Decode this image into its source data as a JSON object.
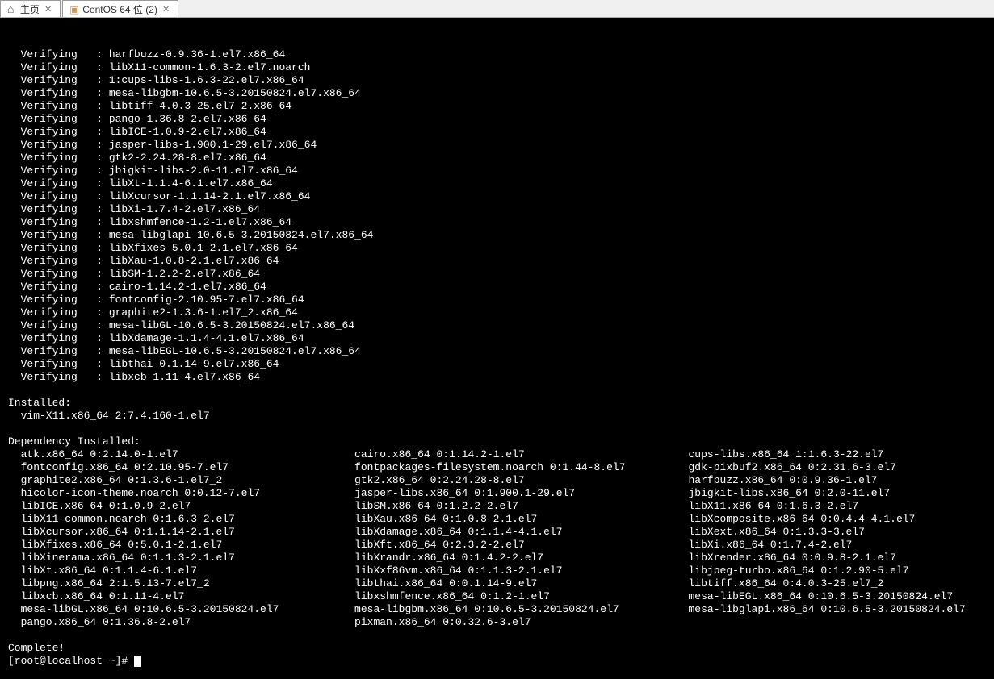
{
  "tabs": {
    "home": "主页",
    "vm": "CentOS 64 位 (2)"
  },
  "verifying_label": "Verifying",
  "verifying": [
    "harfbuzz-0.9.36-1.el7.x86_64",
    "libX11-common-1.6.3-2.el7.noarch",
    "1:cups-libs-1.6.3-22.el7.x86_64",
    "mesa-libgbm-10.6.5-3.20150824.el7.x86_64",
    "libtiff-4.0.3-25.el7_2.x86_64",
    "pango-1.36.8-2.el7.x86_64",
    "libICE-1.0.9-2.el7.x86_64",
    "jasper-libs-1.900.1-29.el7.x86_64",
    "gtk2-2.24.28-8.el7.x86_64",
    "jbigkit-libs-2.0-11.el7.x86_64",
    "libXt-1.1.4-6.1.el7.x86_64",
    "libXcursor-1.1.14-2.1.el7.x86_64",
    "libXi-1.7.4-2.el7.x86_64",
    "libxshmfence-1.2-1.el7.x86_64",
    "mesa-libglapi-10.6.5-3.20150824.el7.x86_64",
    "libXfixes-5.0.1-2.1.el7.x86_64",
    "libXau-1.0.8-2.1.el7.x86_64",
    "libSM-1.2.2-2.el7.x86_64",
    "cairo-1.14.2-1.el7.x86_64",
    "fontconfig-2.10.95-7.el7.x86_64",
    "graphite2-1.3.6-1.el7_2.x86_64",
    "mesa-libGL-10.6.5-3.20150824.el7.x86_64",
    "libXdamage-1.1.4-4.1.el7.x86_64",
    "mesa-libEGL-10.6.5-3.20150824.el7.x86_64",
    "libthai-0.1.14-9.el7.x86_64",
    "libxcb-1.11-4.el7.x86_64"
  ],
  "installed_header": "Installed:",
  "installed_line": "  vim-X11.x86_64 2:7.4.160-1.el7",
  "dep_header": "Dependency Installed:",
  "dep_col1": [
    "atk.x86_64 0:2.14.0-1.el7",
    "fontconfig.x86_64 0:2.10.95-7.el7",
    "graphite2.x86_64 0:1.3.6-1.el7_2",
    "hicolor-icon-theme.noarch 0:0.12-7.el7",
    "libICE.x86_64 0:1.0.9-2.el7",
    "libX11-common.noarch 0:1.6.3-2.el7",
    "libXcursor.x86_64 0:1.1.14-2.1.el7",
    "libXfixes.x86_64 0:5.0.1-2.1.el7",
    "libXinerama.x86_64 0:1.1.3-2.1.el7",
    "libXt.x86_64 0:1.1.4-6.1.el7",
    "libpng.x86_64 2:1.5.13-7.el7_2",
    "libxcb.x86_64 0:1.11-4.el7",
    "mesa-libGL.x86_64 0:10.6.5-3.20150824.el7",
    "pango.x86_64 0:1.36.8-2.el7"
  ],
  "dep_col2": [
    "cairo.x86_64 0:1.14.2-1.el7",
    "fontpackages-filesystem.noarch 0:1.44-8.el7",
    "gtk2.x86_64 0:2.24.28-8.el7",
    "jasper-libs.x86_64 0:1.900.1-29.el7",
    "libSM.x86_64 0:1.2.2-2.el7",
    "libXau.x86_64 0:1.0.8-2.1.el7",
    "libXdamage.x86_64 0:1.1.4-4.1.el7",
    "libXft.x86_64 0:2.3.2-2.el7",
    "libXrandr.x86_64 0:1.4.2-2.el7",
    "libXxf86vm.x86_64 0:1.1.3-2.1.el7",
    "libthai.x86_64 0:0.1.14-9.el7",
    "libxshmfence.x86_64 0:1.2-1.el7",
    "mesa-libgbm.x86_64 0:10.6.5-3.20150824.el7",
    "pixman.x86_64 0:0.32.6-3.el7"
  ],
  "dep_col3": [
    "cups-libs.x86_64 1:1.6.3-22.el7",
    "gdk-pixbuf2.x86_64 0:2.31.6-3.el7",
    "harfbuzz.x86_64 0:0.9.36-1.el7",
    "jbigkit-libs.x86_64 0:2.0-11.el7",
    "libX11.x86_64 0:1.6.3-2.el7",
    "libXcomposite.x86_64 0:0.4.4-4.1.el7",
    "libXext.x86_64 0:1.3.3-3.el7",
    "libXi.x86_64 0:1.7.4-2.el7",
    "libXrender.x86_64 0:0.9.8-2.1.el7",
    "libjpeg-turbo.x86_64 0:1.2.90-5.el7",
    "libtiff.x86_64 0:4.0.3-25.el7_2",
    "mesa-libEGL.x86_64 0:10.6.5-3.20150824.el7",
    "mesa-libglapi.x86_64 0:10.6.5-3.20150824.el7",
    ""
  ],
  "complete": "Complete!",
  "prompt": "[root@localhost ~]# "
}
